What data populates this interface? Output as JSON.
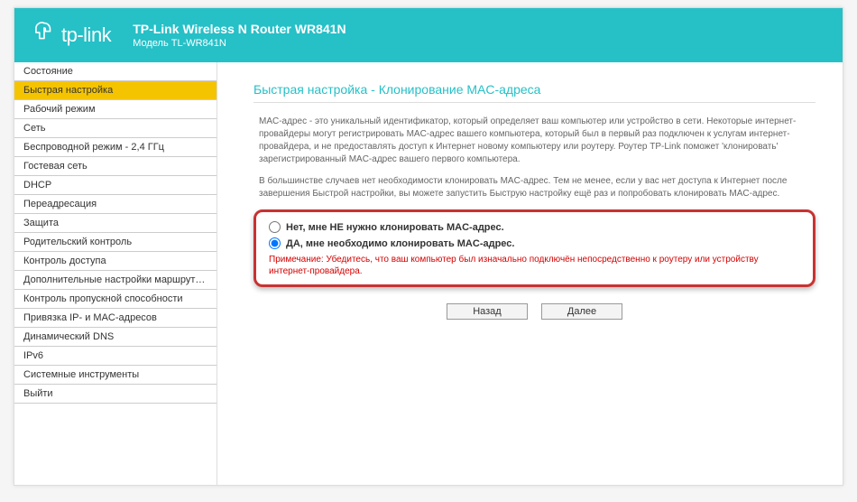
{
  "brand": "tp-link",
  "header": {
    "product_title": "TP-Link Wireless N Router WR841N",
    "model": "Модель TL-WR841N"
  },
  "sidebar": {
    "items": [
      "Состояние",
      "Быстрая настройка",
      "Рабочий режим",
      "Сеть",
      "Беспроводной режим - 2,4 ГГц",
      "Гостевая сеть",
      "DHCP",
      "Переадресация",
      "Защита",
      "Родительский контроль",
      "Контроль доступа",
      "Дополнительные настройки маршрутизации",
      "Контроль пропускной способности",
      "Привязка IP- и MAC-адресов",
      "Динамический DNS",
      "IPv6",
      "Системные инструменты",
      "Выйти"
    ],
    "active_index": 1
  },
  "content": {
    "title": "Быстрая настройка - Клонирование MAC-адреса",
    "desc1": "MAC-адрес - это уникальный идентификатор, который определяет ваш компьютер или устройство в сети. Некоторые интернет-провайдеры могут регистрировать MAC-адрес вашего компьютера, который был в первый раз подключен к услугам интернет-провайдера, и не предоставлять доступ к Интернет новому компьютеру или роутеру. Роутер TP-Link поможет 'клонировать' зарегистрированный MAC-адрес вашего первого компьютера.",
    "desc2": "В большинстве случаев нет необходимости клонировать MAC-адрес. Тем не менее, если у вас нет доступа к Интернет после завершения Быстрой настройки, вы можете запустить Быструю настройку ещё раз и попробовать клонировать MAC-адрес.",
    "option_no": "Нет, мне НЕ нужно клонировать MAC-адрес.",
    "option_yes": "ДА, мне необходимо клонировать MAC-адрес.",
    "selected": "yes",
    "note": "Примечание: Убедитесь, что ваш компьютер был изначально подключён непосредственно к роутеру или устройству интернет-провайдера.",
    "btn_back": "Назад",
    "btn_next": "Далее"
  }
}
